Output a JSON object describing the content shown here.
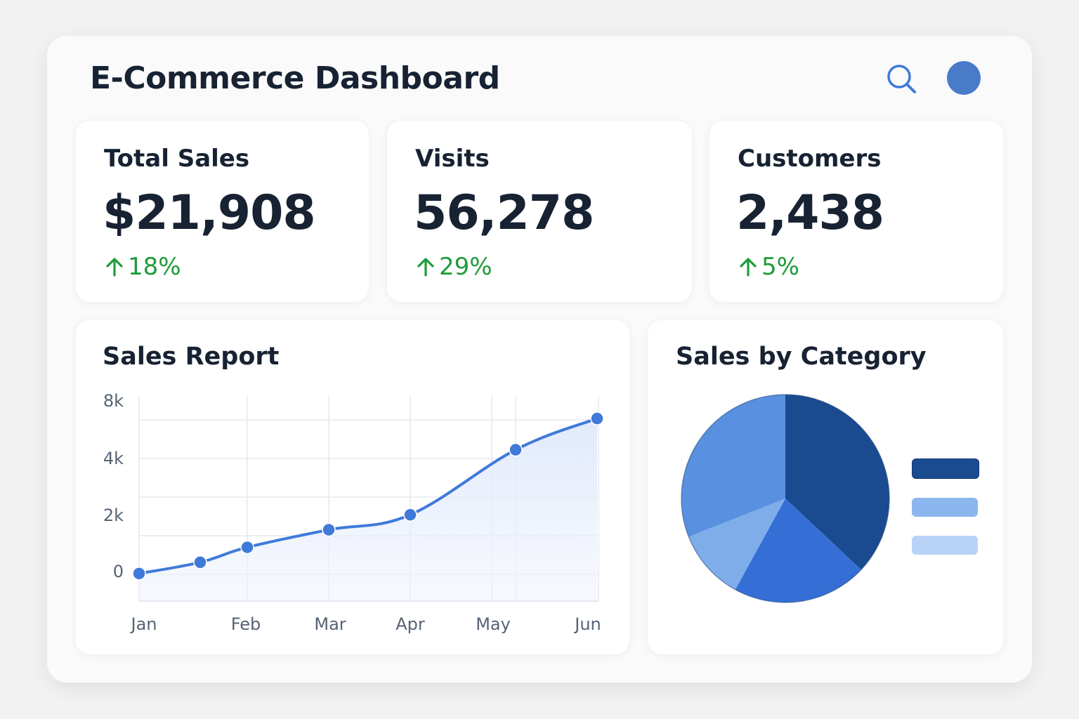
{
  "header": {
    "title": "E-Commerce Dashboard",
    "search_icon": "search-icon",
    "avatar_color": "#4a7bc9"
  },
  "stats": [
    {
      "label": "Total Sales",
      "value": "$21,908",
      "change": "18%",
      "trend": "up"
    },
    {
      "label": "Visits",
      "value": "56,278",
      "change": "29%",
      "trend": "up"
    },
    {
      "label": "Customers",
      "value": "2,438",
      "change": "5%",
      "trend": "up"
    }
  ],
  "colors": {
    "accent": "#3f7ad9",
    "positive": "#1e9c3a",
    "pie": [
      "#1a4a8f",
      "#356fd5",
      "#7eadea",
      "#5a90e0"
    ],
    "legend": [
      "#1a4a8f",
      "#8cb6ee",
      "#b9d3f7"
    ]
  },
  "sales_report": {
    "title": "Sales Report",
    "chart_data": {
      "type": "line",
      "title": "Sales Report",
      "x_labels": [
        "Jan",
        "Feb",
        "Mar",
        "Apr",
        "May",
        "Jun"
      ],
      "y_ticks": [
        "8k",
        "4k",
        "2k",
        "0"
      ],
      "x": [
        "Jan",
        "",
        "Feb",
        "Mar",
        "Apr",
        "May",
        "Jun"
      ],
      "values": [
        0.3,
        1.2,
        2.4,
        3.8,
        5.0,
        10.2,
        12.7
      ],
      "ylim": [
        -1.9,
        14.5
      ],
      "grid": true,
      "area_fill": true
    }
  },
  "sales_by_category": {
    "title": "Sales by Category",
    "chart_data": {
      "type": "pie",
      "title": "Sales by Category",
      "categories": [
        "",
        "",
        "",
        ""
      ],
      "values": [
        37,
        21,
        11,
        31
      ],
      "legend_position": "right"
    }
  }
}
